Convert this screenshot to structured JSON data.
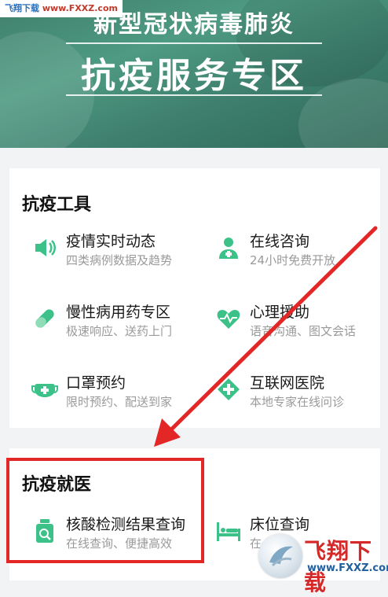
{
  "watermark_top": {
    "prefix": "飞翔下载",
    "url": "www.FXXZ.com"
  },
  "banner": {
    "line1": "新型冠状病毒肺炎",
    "line2": "抗疫服务专区"
  },
  "sections": {
    "tools": {
      "title": "抗疫工具",
      "items": [
        {
          "name": "疫情实时动态",
          "sub": "四类病例数据及趋势",
          "icon": "speaker-icon"
        },
        {
          "name": "在线咨询",
          "sub": "24小时免费开放",
          "icon": "doctor-icon"
        },
        {
          "name": "慢性病用药专区",
          "sub": "极速响应、送药上门",
          "icon": "pill-icon"
        },
        {
          "name": "心理援助",
          "sub": "语音沟通、图文会话",
          "icon": "heart-pulse-icon"
        },
        {
          "name": "口罩预约",
          "sub": "限时预约、配送到家",
          "icon": "mask-icon"
        },
        {
          "name": "互联网医院",
          "sub": "本地专家在线问诊",
          "icon": "hospital-cross-icon"
        }
      ]
    },
    "medical": {
      "title": "抗疫就医",
      "items": [
        {
          "name": "核酸检测结果查询",
          "sub": "在线查询、便捷高效",
          "icon": "test-bottle-icon"
        },
        {
          "name": "床位查询",
          "sub": "在",
          "icon": "bed-icon"
        }
      ]
    }
  },
  "watermark_bottom": {
    "brand": "飞翔下载",
    "url": "www.FXXZ.com"
  },
  "colors": {
    "accent": "#3cc289",
    "highlight": "#e32626",
    "banner": "#3f7f6b"
  }
}
